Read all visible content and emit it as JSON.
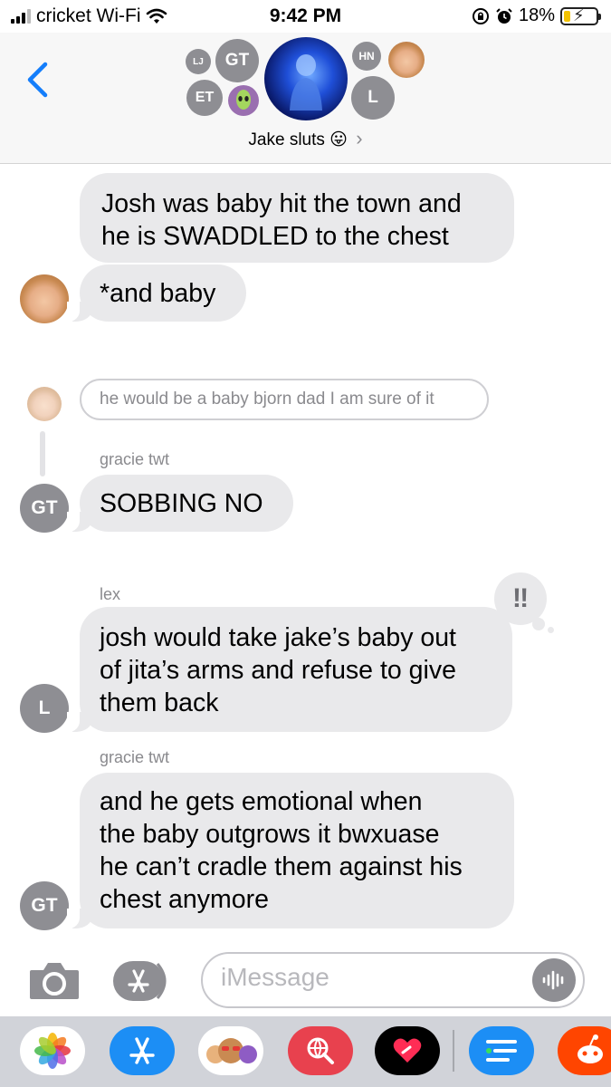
{
  "status_bar": {
    "carrier": "cricket Wi-Fi",
    "time": "9:42 PM",
    "battery": "18%"
  },
  "header": {
    "avatars": {
      "lj": "LJ",
      "gt": "GT",
      "et": "ET",
      "hn": "HN",
      "l": "L"
    },
    "group_name": "Jake sluts",
    "group_emoji": "😛",
    "chevron": "›"
  },
  "messages": [
    {
      "text_lines": [
        "Josh was baby hit the town and",
        "he is SWADDLED to the chest"
      ]
    },
    {
      "text": "*and baby"
    },
    {
      "reply_preview": "he would be a baby bjorn dad I am sure of it"
    },
    {
      "sender": "gracie twt",
      "avatar": "GT",
      "text": "SOBBING NO"
    },
    {
      "sender": "lex",
      "avatar": "L",
      "tapback": "‼",
      "text_lines": [
        "josh would take jake’s baby out",
        "of jita’s arms and refuse to give",
        "them back"
      ]
    },
    {
      "sender": "gracie twt",
      "avatar": "GT",
      "text_lines": [
        "and he gets emotional when",
        "the baby outgrows it bwxuase",
        "he can’t cradle them against his",
        "chest anymore"
      ]
    }
  ],
  "input": {
    "placeholder": "iMessage"
  },
  "colors": {
    "blue": "#147efb",
    "bubble_gray": "#e9e9eb",
    "avatar_gray": "#8e8e93"
  }
}
